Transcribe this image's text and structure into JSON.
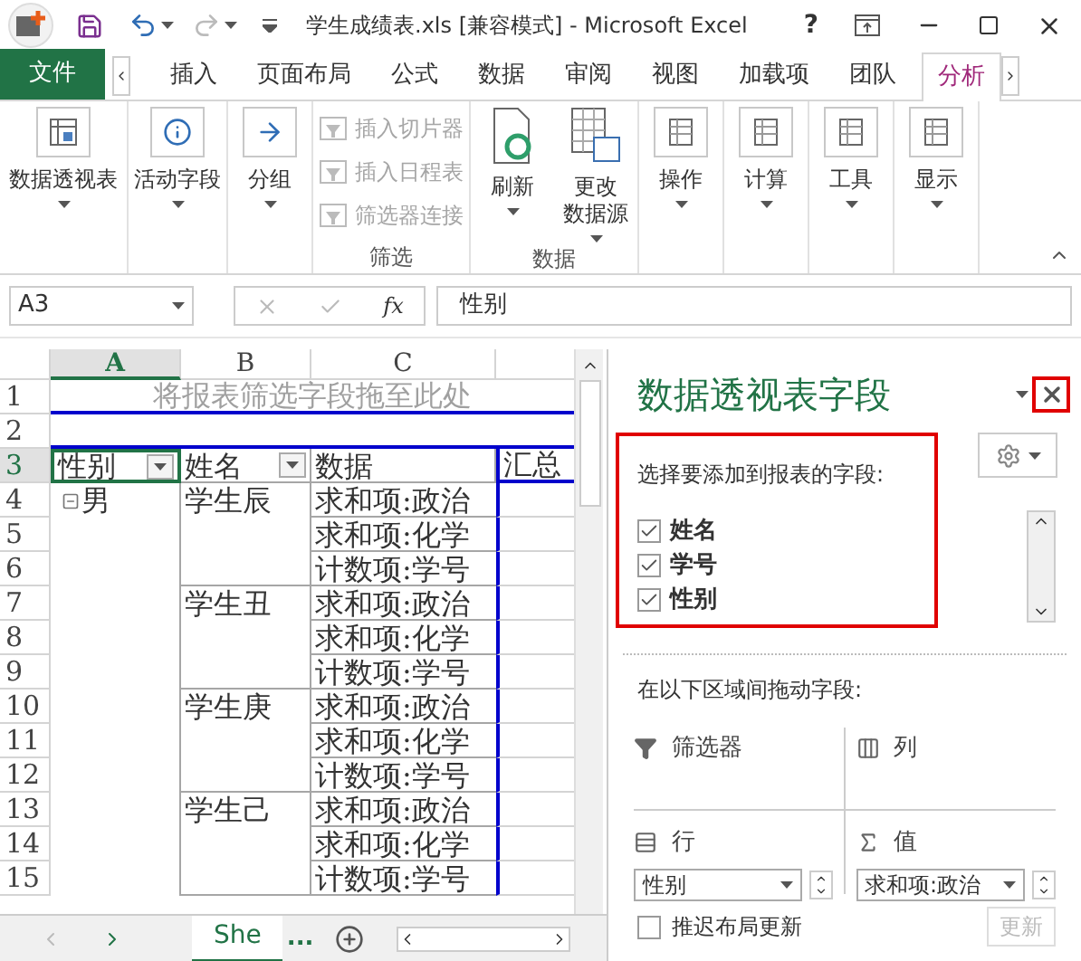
{
  "title_bar": {
    "title": "学生成绩表.xls  [兼容模式] - Microsoft Excel",
    "help": "?"
  },
  "ribbon_tabs": [
    {
      "label": "文件",
      "kind": "file",
      "selected": false
    },
    {
      "label": "插入",
      "kind": "tab",
      "selected": false
    },
    {
      "label": "页面布局",
      "kind": "tab",
      "selected": false
    },
    {
      "label": "公式",
      "kind": "tab",
      "selected": false
    },
    {
      "label": "数据",
      "kind": "tab",
      "selected": false
    },
    {
      "label": "审阅",
      "kind": "tab",
      "selected": false
    },
    {
      "label": "视图",
      "kind": "tab",
      "selected": false
    },
    {
      "label": "加载项",
      "kind": "tab",
      "selected": false
    },
    {
      "label": "团队",
      "kind": "tab",
      "selected": false
    },
    {
      "label": "分析",
      "kind": "tab",
      "selected": true
    }
  ],
  "ribbon_groups": [
    {
      "buttons": [
        {
          "kind": "large",
          "lines": [
            "数据透视表"
          ],
          "disabled": false
        }
      ]
    },
    {
      "buttons": [
        {
          "kind": "large",
          "lines": [
            "活动字段"
          ],
          "disabled": false
        }
      ]
    },
    {
      "buttons": [
        {
          "kind": "large",
          "lines": [
            "分组"
          ],
          "disabled": false
        }
      ]
    },
    {
      "label": "筛选",
      "buttons": [
        {
          "kind": "small",
          "lines": [
            "插入切片器"
          ],
          "disabled": true
        },
        {
          "kind": "small",
          "lines": [
            "插入日程表"
          ],
          "disabled": true
        },
        {
          "kind": "small",
          "lines": [
            "筛选器连接"
          ],
          "disabled": true
        }
      ]
    },
    {
      "label": "数据",
      "buttons": [
        {
          "kind": "tall",
          "lines": [
            "刷新"
          ],
          "disabled": false
        },
        {
          "kind": "tall",
          "lines": [
            "更改",
            "数据源"
          ],
          "disabled": false
        }
      ]
    },
    {
      "buttons": [
        {
          "kind": "large",
          "lines": [
            "操作"
          ],
          "disabled": false
        }
      ]
    },
    {
      "buttons": [
        {
          "kind": "large",
          "lines": [
            "计算"
          ],
          "disabled": false
        }
      ]
    },
    {
      "buttons": [
        {
          "kind": "large",
          "lines": [
            "工具"
          ],
          "disabled": false
        }
      ]
    },
    {
      "buttons": [
        {
          "kind": "large",
          "lines": [
            "显示"
          ],
          "disabled": false
        }
      ]
    }
  ],
  "formula_bar": {
    "name_box": "A3",
    "fx": "fx",
    "formula": "性别"
  },
  "sheet": {
    "columns": [
      {
        "label": "A",
        "selected": true
      },
      {
        "label": "B",
        "selected": false
      },
      {
        "label": "C",
        "selected": false
      }
    ],
    "row_numbers": [
      {
        "label": "1",
        "selected": false
      },
      {
        "label": "2",
        "selected": false
      },
      {
        "label": "3",
        "selected": true
      },
      {
        "label": "4",
        "selected": false
      },
      {
        "label": "5",
        "selected": false
      },
      {
        "label": "6",
        "selected": false
      },
      {
        "label": "7",
        "selected": false
      },
      {
        "label": "8",
        "selected": false
      },
      {
        "label": "9",
        "selected": false
      },
      {
        "label": "10",
        "selected": false
      },
      {
        "label": "11",
        "selected": false
      },
      {
        "label": "12",
        "selected": false
      },
      {
        "label": "13",
        "selected": false
      },
      {
        "label": "14",
        "selected": false
      },
      {
        "label": "15",
        "selected": false
      }
    ],
    "filter_hint": "将报表筛选字段拖至此处",
    "header": [
      {
        "label": "性别",
        "filter": true
      },
      {
        "label": "姓名",
        "filter": true
      },
      {
        "label": "数据",
        "filter": false
      },
      {
        "label": "汇总",
        "filter": false
      }
    ],
    "group": {
      "label": "男",
      "expanded": true
    },
    "students": [
      {
        "name": "学生辰",
        "values": [
          "求和项:政治",
          "求和项:化学",
          "计数项:学号"
        ]
      },
      {
        "name": "学生丑",
        "values": [
          "求和项:政治",
          "求和项:化学",
          "计数项:学号"
        ]
      },
      {
        "name": "学生庚",
        "values": [
          "求和项:政治",
          "求和项:化学",
          "计数项:学号"
        ]
      },
      {
        "name": "学生己",
        "values": [
          "求和项:政治",
          "求和项:化学",
          "计数项:学号"
        ]
      }
    ],
    "sheet_tabs": [
      {
        "label": "She",
        "selected": true
      }
    ],
    "more_tabs": "..."
  },
  "pivot_pane": {
    "title": "数据透视表字段",
    "prompt": "选择要添加到报表的字段:",
    "fields": [
      {
        "label": "姓名",
        "checked": true
      },
      {
        "label": "学号",
        "checked": true
      },
      {
        "label": "性别",
        "checked": true
      }
    ],
    "areas_prompt": "在以下区域间拖动字段:",
    "areas": [
      {
        "kind": "filter",
        "label": "筛选器"
      },
      {
        "kind": "columns",
        "label": "列"
      },
      {
        "kind": "rows",
        "label": "行",
        "items": [
          "性别"
        ]
      },
      {
        "kind": "values",
        "label": "值",
        "items": [
          "求和项:政治"
        ]
      }
    ],
    "defer": {
      "label": "推迟布局更新",
      "checked": false
    },
    "update_button": {
      "label": "更新",
      "disabled": true
    }
  }
}
